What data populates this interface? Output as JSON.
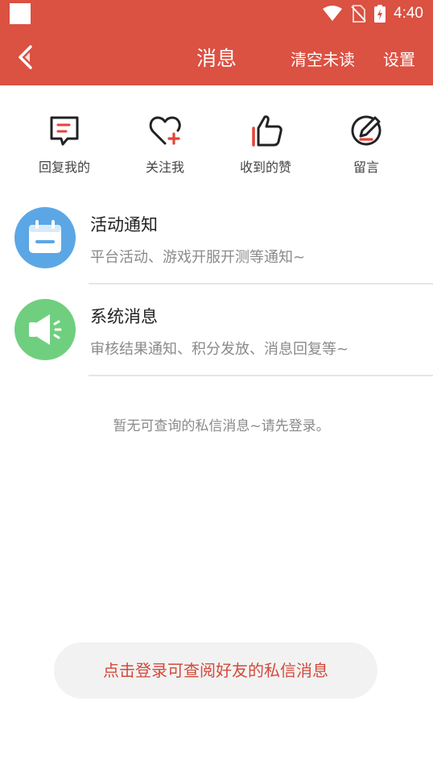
{
  "status_bar": {
    "time": "4:40"
  },
  "header": {
    "title": "消息",
    "clear_unread": "清空未读",
    "settings": "设置"
  },
  "quick_actions": [
    {
      "label": "回复我的",
      "icon": "chat-bubble-icon"
    },
    {
      "label": "关注我",
      "icon": "heart-plus-icon"
    },
    {
      "label": "收到的赞",
      "icon": "thumbs-up-icon"
    },
    {
      "label": "留言",
      "icon": "edit-pen-icon"
    }
  ],
  "message_list": [
    {
      "title": "活动通知",
      "subtitle": "平台活动、游戏开服开测等通知~",
      "icon": "calendar-icon",
      "color": "#5ba7e6"
    },
    {
      "title": "系统消息",
      "subtitle": "审核结果通知、积分发放、消息回复等~",
      "icon": "speaker-icon",
      "color": "#6fcf7f"
    }
  ],
  "empty_note": "暂无可查询的私信消息~请先登录。",
  "login_button": "点击登录可查阅好友的私信消息",
  "colors": {
    "brand": "#db5142",
    "accent_text": "#d24a3b"
  }
}
